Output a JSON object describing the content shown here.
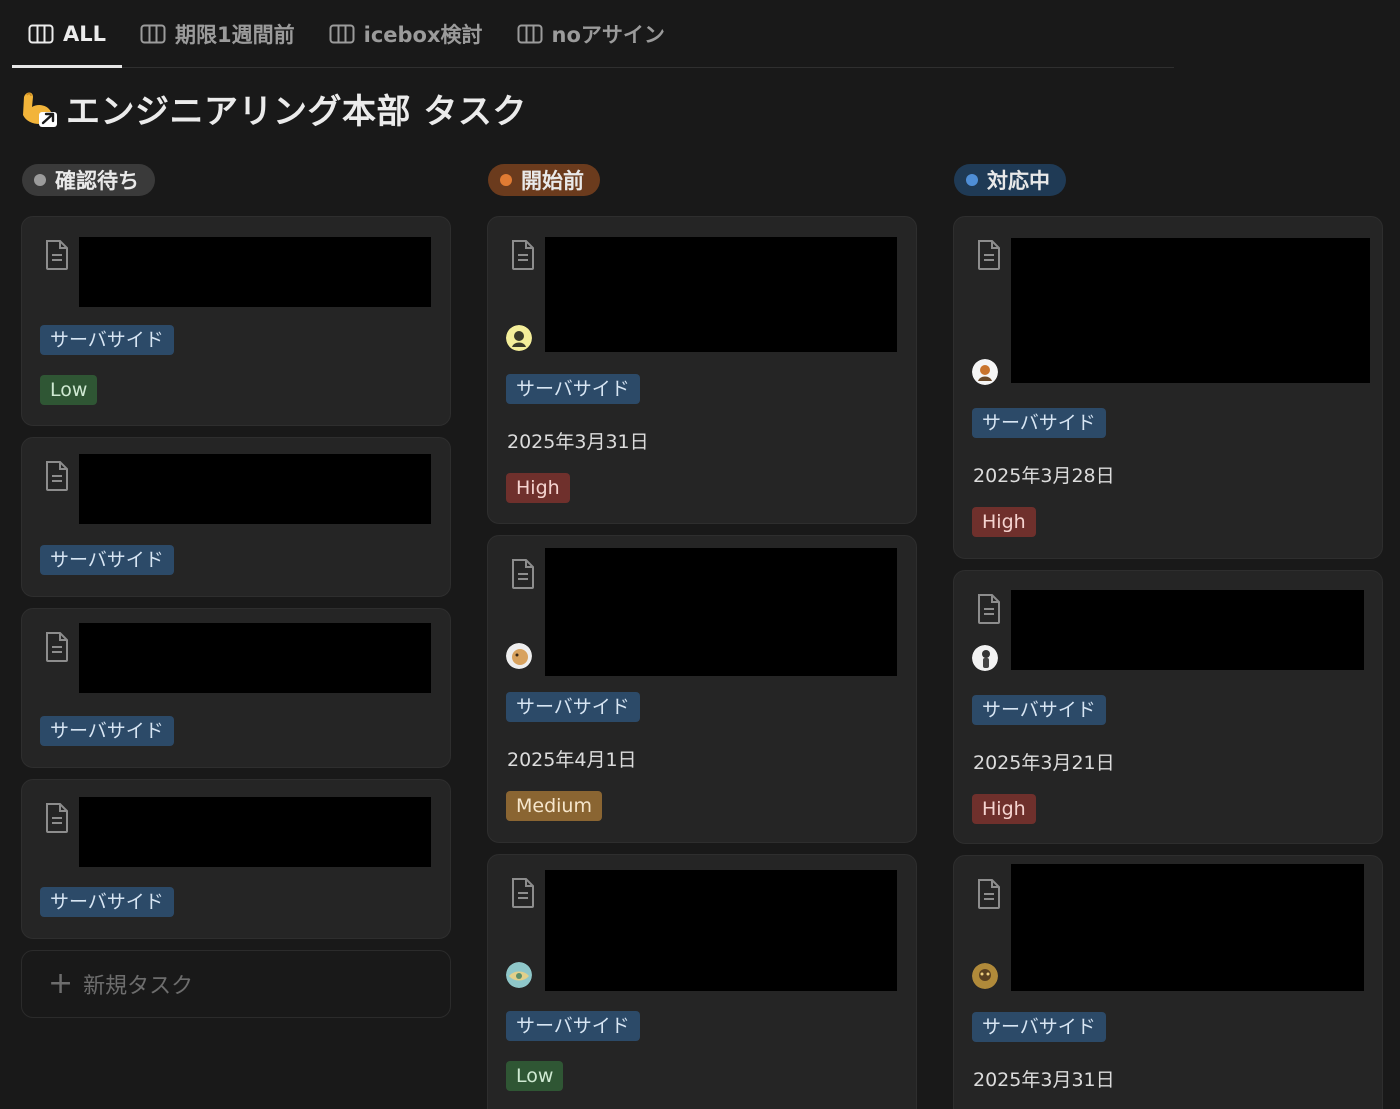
{
  "tabs": [
    {
      "label": "ALL",
      "icon": "board-view-icon",
      "active": true
    },
    {
      "label": "期限1週間前",
      "icon": "board-view-icon",
      "active": false
    },
    {
      "label": "icebox検討",
      "icon": "board-view-icon",
      "active": false
    },
    {
      "label": "noアサイン",
      "icon": "board-view-icon",
      "active": false
    }
  ],
  "page": {
    "emoji": "flexed-biceps-icon",
    "title": "エンジニアリング本部 タスク"
  },
  "columns": [
    {
      "status": "確認待ち",
      "pill_color": "#3a3a3a",
      "dot_color": "#9b9b9b",
      "cards": [
        {
          "tag": "サーバサイド",
          "priority": "Low"
        },
        {
          "tag": "サーバサイド"
        },
        {
          "tag": "サーバサイド"
        },
        {
          "tag": "サーバサイド"
        }
      ],
      "new_task_label": "新規タスク"
    },
    {
      "status": "開始前",
      "pill_color": "#6b3b1d",
      "dot_color": "#e07b33",
      "cards": [
        {
          "tag": "サーバサイド",
          "date": "2025年3月31日",
          "priority": "High"
        },
        {
          "tag": "サーバサイド",
          "date": "2025年4月1日",
          "priority": "Medium"
        },
        {
          "tag": "サーバサイド",
          "priority": "Low"
        }
      ]
    },
    {
      "status": "対応中",
      "pill_color": "#1f3a55",
      "dot_color": "#4f8ed6",
      "cards": [
        {
          "tag": "サーバサイド",
          "date": "2025年3月28日",
          "priority": "High"
        },
        {
          "tag": "サーバサイド",
          "date": "2025年3月21日",
          "priority": "High"
        },
        {
          "tag": "サーバサイド",
          "date": "2025年3月31日"
        }
      ]
    }
  ]
}
